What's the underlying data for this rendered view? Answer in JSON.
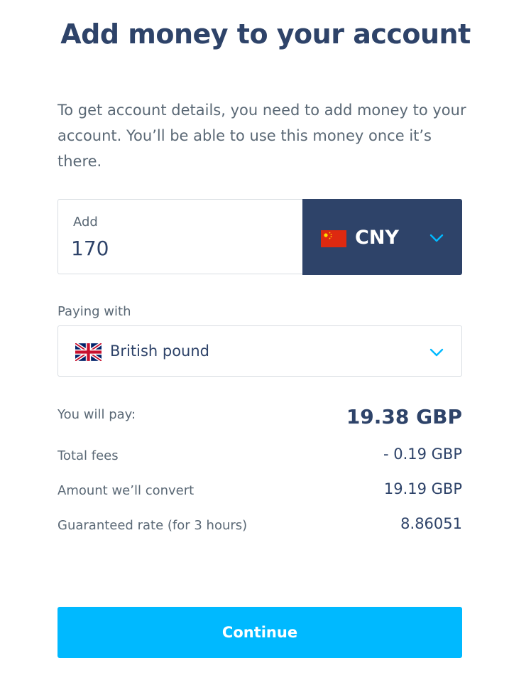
{
  "page": {
    "title": "Add money to your account",
    "intro": "To get account details, you need to add money to your account. You’ll be able to use this money once it’s there."
  },
  "amount": {
    "label": "Add",
    "value": "170",
    "currency": {
      "code": "CNY",
      "flag_icon": "china-flag-icon"
    }
  },
  "paying_with": {
    "label": "Paying with",
    "selected": "British pound",
    "flag_icon": "uk-flag-icon"
  },
  "summary": {
    "you_will_pay": {
      "label": "You will pay:",
      "value": "19.38 GBP"
    },
    "total_fees": {
      "label": "Total fees",
      "value": "- 0.19 GBP"
    },
    "amount_convert": {
      "label": "Amount we’ll convert",
      "value": "19.19 GBP"
    },
    "guaranteed_rate": {
      "label": "Guaranteed rate (for 3 hours)",
      "value": "8.86051"
    }
  },
  "actions": {
    "continue_label": "Continue"
  },
  "colors": {
    "navy": "#2e4369",
    "accent_blue": "#00b9ff",
    "muted_text": "#5a6875",
    "border": "#d8dde2"
  }
}
